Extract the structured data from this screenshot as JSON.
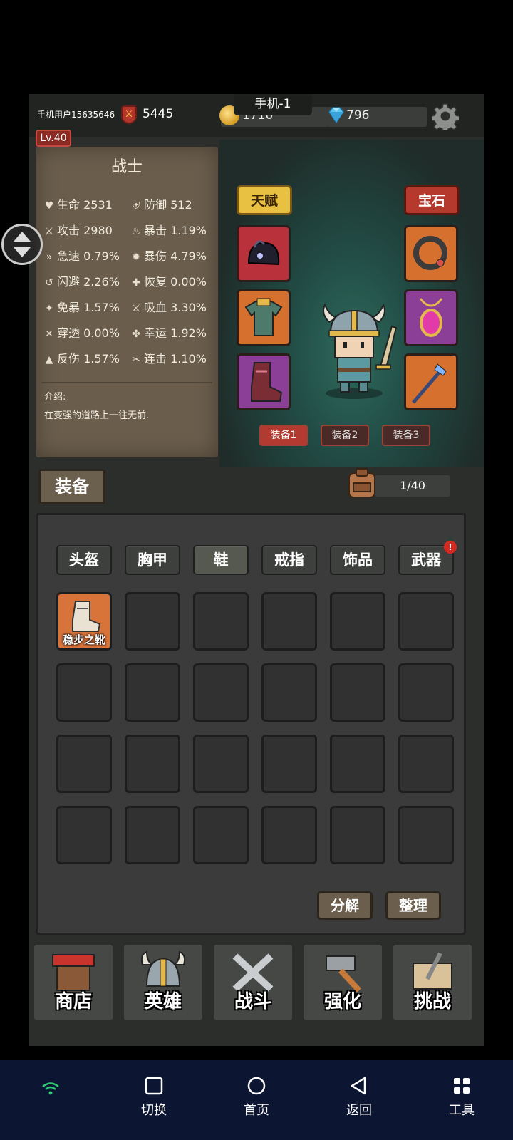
{
  "device_tag": "手机-1",
  "header": {
    "username": "手机用户15635646",
    "power": "5445",
    "gold": "1710",
    "gems": "796",
    "level": "Lv.40"
  },
  "hero": {
    "class_name": "战士",
    "stats": [
      {
        "label": "生命",
        "value": "2531",
        "icon": "heart-icon"
      },
      {
        "label": "防御",
        "value": "512",
        "icon": "shield-icon"
      },
      {
        "label": "攻击",
        "value": "2980",
        "icon": "sword-icon"
      },
      {
        "label": "暴击",
        "value": "1.19%",
        "icon": "flame-icon"
      },
      {
        "label": "急速",
        "value": "0.79%",
        "icon": "speed-icon"
      },
      {
        "label": "暴伤",
        "value": "4.79%",
        "icon": "burst-icon"
      },
      {
        "label": "闪避",
        "value": "2.26%",
        "icon": "dodge-icon"
      },
      {
        "label": "恢复",
        "value": "0.00%",
        "icon": "heal-icon"
      },
      {
        "label": "免暴",
        "value": "1.57%",
        "icon": "crit-resist-icon"
      },
      {
        "label": "吸血",
        "value": "3.30%",
        "icon": "lifesteal-icon"
      },
      {
        "label": "穿透",
        "value": "0.00%",
        "icon": "pierce-icon"
      },
      {
        "label": "幸运",
        "value": "1.92%",
        "icon": "clover-icon"
      },
      {
        "label": "反伤",
        "value": "1.57%",
        "icon": "thorns-icon"
      },
      {
        "label": "连击",
        "value": "1.10%",
        "icon": "combo-icon"
      }
    ],
    "intro_label": "介绍:",
    "intro_text": "在变强的道路上一往无前."
  },
  "scene": {
    "talent_label": "天赋",
    "gem_label": "宝石",
    "loadouts": [
      "装备1",
      "装备2",
      "装备3"
    ]
  },
  "equipment": {
    "section_label": "装备",
    "capacity": "1/40",
    "categories": [
      "头盔",
      "胸甲",
      "鞋",
      "戒指",
      "饰品",
      "武器"
    ],
    "first_item": "稳步之靴",
    "decompose_label": "分解",
    "sort_label": "整理"
  },
  "nav": [
    "商店",
    "英雄",
    "战斗",
    "强化",
    "挑战"
  ],
  "system_bar": [
    "切换",
    "首页",
    "返回",
    "工具"
  ]
}
